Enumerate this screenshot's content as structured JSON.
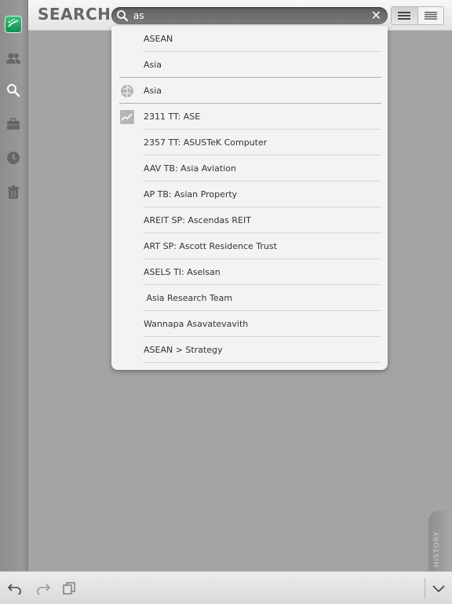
{
  "app": {
    "title": "SEARCH"
  },
  "search": {
    "value": "as",
    "placeholder": "",
    "clear_glyph": "✕"
  },
  "rail": {
    "items": [
      {
        "name": "logo",
        "icon": "brand-logo"
      },
      {
        "name": "contacts",
        "icon": "people-icon"
      },
      {
        "name": "search",
        "icon": "search-icon"
      },
      {
        "name": "portfolio",
        "icon": "briefcase-icon"
      },
      {
        "name": "history",
        "icon": "clock-icon"
      },
      {
        "name": "trash",
        "icon": "trash-icon"
      }
    ]
  },
  "results": [
    {
      "label": "ASEAN",
      "icon": ""
    },
    {
      "label": "Asia",
      "icon": ""
    },
    {
      "label": "Asia",
      "icon": "globe-icon"
    },
    {
      "label": "2311 TT: ASE",
      "icon": "chart-icon"
    },
    {
      "label": "2357 TT: ASUSTeK Computer",
      "icon": ""
    },
    {
      "label": "AAV TB: Asia Aviation",
      "icon": ""
    },
    {
      "label": "AP TB: Asian Property",
      "icon": ""
    },
    {
      "label": "AREIT SP: Ascendas REIT",
      "icon": ""
    },
    {
      "label": "ART SP: Ascott Residence Trust",
      "icon": ""
    },
    {
      "label": "ASELS TI: Aselsan",
      "icon": ""
    },
    {
      "label": " Asia Research Team",
      "icon": ""
    },
    {
      "label": "Wannapa Asavatevavith",
      "icon": ""
    },
    {
      "label": "ASEAN > Strategy",
      "icon": ""
    }
  ],
  "history_tab": {
    "label": "HISTORY"
  },
  "colors": {
    "brand": "#1fa866",
    "background": "#a4a4a4"
  }
}
